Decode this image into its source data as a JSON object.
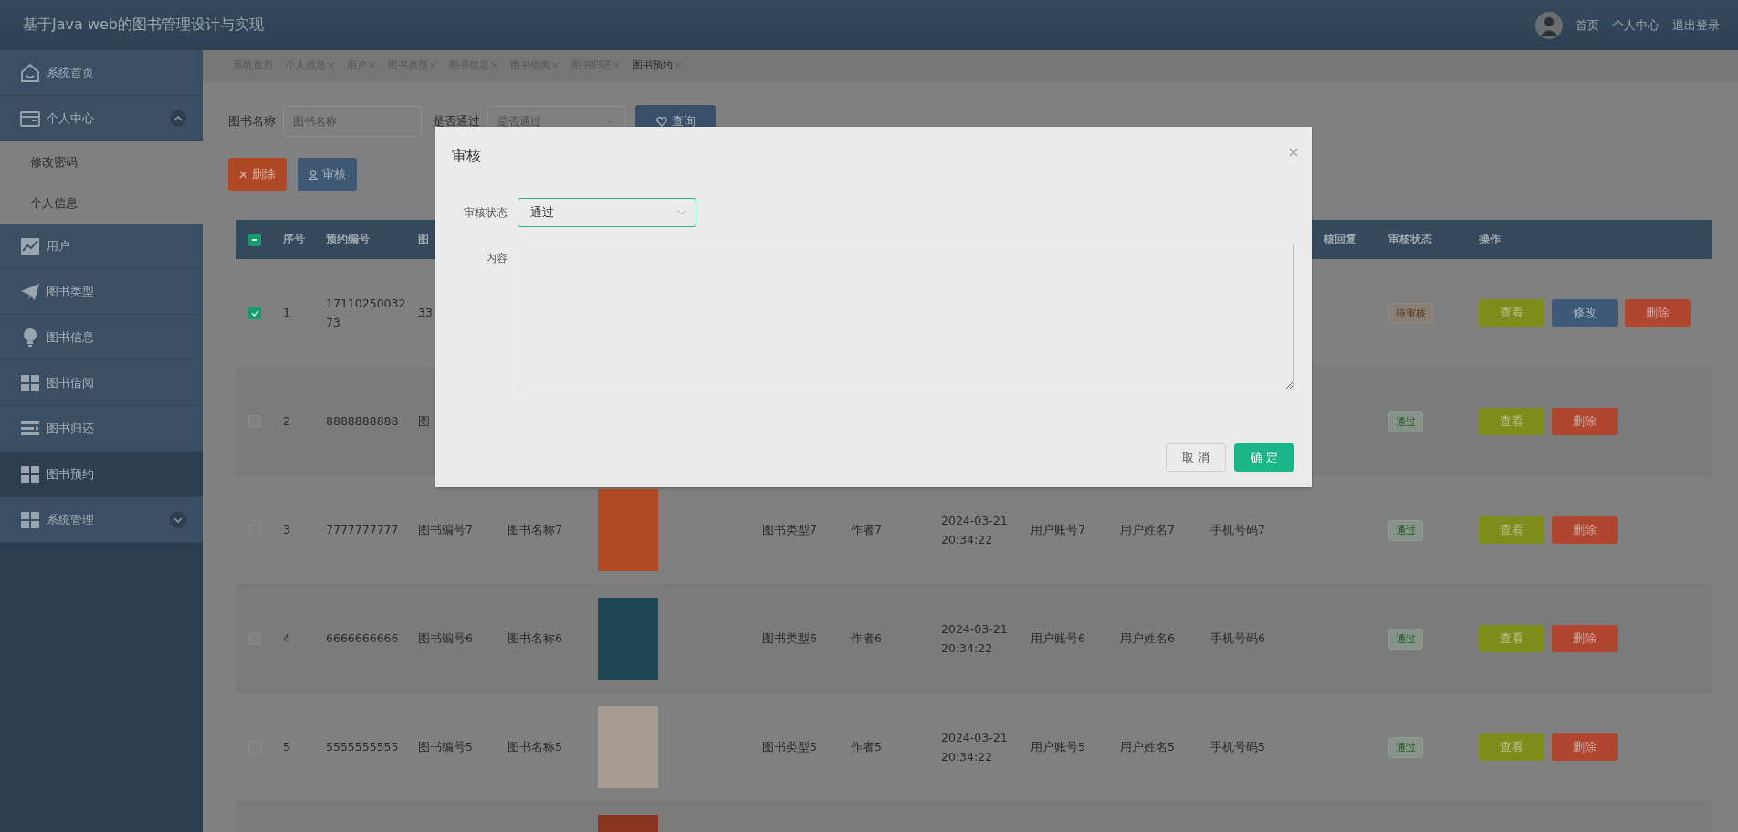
{
  "header": {
    "title": "基于Java web的图书管理设计与实现",
    "nav": [
      "首页",
      "个人中心",
      "退出登录"
    ]
  },
  "sidebar": {
    "items": [
      {
        "label": "系统首页",
        "selected": false
      },
      {
        "label": "个人中心",
        "selected": false,
        "expanded": true,
        "children": [
          {
            "label": "修改密码"
          },
          {
            "label": "个人信息"
          }
        ]
      },
      {
        "label": "用户",
        "selected": false
      },
      {
        "label": "图书类型",
        "selected": false
      },
      {
        "label": "图书信息",
        "selected": false
      },
      {
        "label": "图书借阅",
        "selected": false
      },
      {
        "label": "图书归还",
        "selected": false
      },
      {
        "label": "图书预约",
        "selected": true
      },
      {
        "label": "系统管理",
        "selected": false,
        "expanded": false
      }
    ]
  },
  "tabs": [
    {
      "label": "系统首页",
      "selected": false,
      "closable": false
    },
    {
      "label": "个人信息",
      "selected": false,
      "closable": true
    },
    {
      "label": "用户",
      "selected": false,
      "closable": true
    },
    {
      "label": "图书类型",
      "selected": false,
      "closable": true
    },
    {
      "label": "图书信息",
      "selected": false,
      "closable": true
    },
    {
      "label": "图书借阅",
      "selected": false,
      "closable": true
    },
    {
      "label": "图书归还",
      "selected": false,
      "closable": true
    },
    {
      "label": "图书预约",
      "selected": true,
      "closable": true
    }
  ],
  "search": {
    "fields": [
      {
        "kind": "text",
        "label": "图书名称",
        "placeholder": "图书名称"
      },
      {
        "kind": "select",
        "label": "是否通过",
        "placeholder": "是否通过"
      }
    ],
    "button": "查询"
  },
  "toolbar": [
    {
      "kind": "delete",
      "label": "删除"
    },
    {
      "kind": "review",
      "label": "审核"
    }
  ],
  "table": {
    "select_all_indeterminate": true,
    "header": {
      "index": "序号",
      "reservation_no": "预约编号",
      "book_no": "图",
      "review_reply": "核回复",
      "review_status": "审核状态",
      "actions": "操作"
    },
    "rows": [
      {
        "checked": true,
        "index": "1",
        "reservation_no": "1711025003273",
        "book_no": "33",
        "review_status": {
          "kind": "pending",
          "label": "待审核"
        },
        "actions": [
          {
            "kind": "view",
            "label": "查看"
          },
          {
            "kind": "edit",
            "label": "修改"
          },
          {
            "kind": "delete",
            "label": "删除"
          }
        ]
      },
      {
        "checked": false,
        "index": "2",
        "reservation_no": "8888888888",
        "book_no": "图",
        "review_status": {
          "kind": "approved",
          "label": "通过"
        },
        "actions": [
          {
            "kind": "view",
            "label": "查看"
          },
          {
            "kind": "delete",
            "label": "删除"
          }
        ]
      },
      {
        "checked": false,
        "index": "3",
        "reservation_no": "7777777777",
        "book_no": "图书编号7",
        "book_name": "图书名称7",
        "cover": {
          "color": "#b04a22"
        },
        "book_type": "图书类型7",
        "author": "作者7",
        "reserved_at": "2024-03-21 20:34:22",
        "user_account": "用户账号7",
        "user_name": "用户姓名7",
        "phone": "手机号码7",
        "review_status": {
          "kind": "approved",
          "label": "通过"
        },
        "actions": [
          {
            "kind": "view",
            "label": "查看"
          },
          {
            "kind": "delete",
            "label": "删除"
          }
        ]
      },
      {
        "checked": false,
        "index": "4",
        "reservation_no": "6666666666",
        "book_no": "图书编号6",
        "book_name": "图书名称6",
        "cover": {
          "color": "#1f4652"
        },
        "book_type": "图书类型6",
        "author": "作者6",
        "reserved_at": "2024-03-21 20:34:22",
        "user_account": "用户账号6",
        "user_name": "用户姓名6",
        "phone": "手机号码6",
        "review_status": {
          "kind": "approved",
          "label": "通过"
        },
        "actions": [
          {
            "kind": "view",
            "label": "查看"
          },
          {
            "kind": "delete",
            "label": "删除"
          }
        ]
      },
      {
        "checked": false,
        "index": "5",
        "reservation_no": "5555555555",
        "book_no": "图书编号5",
        "book_name": "图书名称5",
        "cover": {
          "color": "#a59d92"
        },
        "book_type": "图书类型5",
        "author": "作者5",
        "reserved_at": "2024-03-21 20:34:22",
        "user_account": "用户账号5",
        "user_name": "用户姓名5",
        "phone": "手机号码5",
        "review_status": {
          "kind": "approved",
          "label": "通过"
        },
        "actions": [
          {
            "kind": "view",
            "label": "查看"
          },
          {
            "kind": "delete",
            "label": "删除"
          }
        ]
      },
      {
        "cover": {
          "color": "#8a3320"
        }
      }
    ]
  },
  "dialog": {
    "title": "审核",
    "fields": [
      {
        "kind": "select",
        "label": "审核状态",
        "value": "通过"
      },
      {
        "kind": "textarea",
        "label": "内容"
      }
    ],
    "buttons": [
      {
        "kind": "cancel",
        "label": "取 消"
      },
      {
        "kind": "confirm",
        "label": "确 定"
      }
    ]
  }
}
